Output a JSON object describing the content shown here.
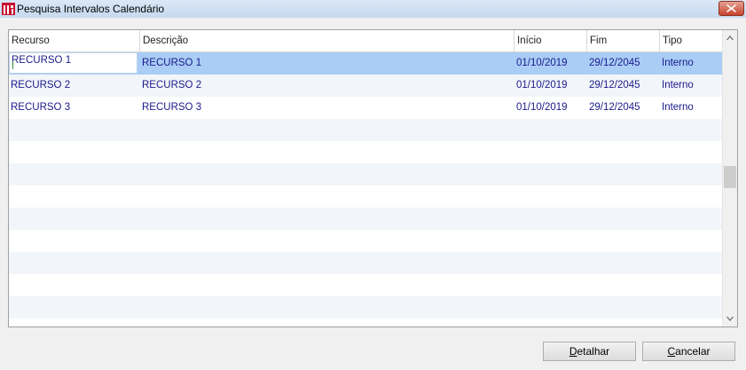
{
  "window": {
    "title": "Pesquisa Intervalos Calendário"
  },
  "grid": {
    "columns": [
      "Recurso",
      "Descrição",
      "Início",
      "Fim",
      "Tipo"
    ],
    "rows": [
      [
        "RECURSO 1",
        "RECURSO 1",
        "01/10/2019",
        "29/12/2045",
        "Interno"
      ],
      [
        "RECURSO 2",
        "RECURSO 2",
        "01/10/2019",
        "29/12/2045",
        "Interno"
      ],
      [
        "RECURSO 3",
        "RECURSO 3",
        "01/10/2019",
        "29/12/2045",
        "Interno"
      ]
    ],
    "selected_row": 0
  },
  "buttons": {
    "detalhar": {
      "first": "D",
      "rest": "etalhar"
    },
    "cancelar": {
      "first": "C",
      "rest": "ancelar"
    }
  },
  "icons": {
    "app": "app-logo-icon",
    "close": "close-icon",
    "scroll_up": "chevron-up-icon",
    "scroll_down": "chevron-down-icon"
  },
  "colors": {
    "selection": "#a9cdf5",
    "row_text": "#1a1a8c",
    "alt_row": "#f2f5f9",
    "close_button": "#c7432a"
  }
}
